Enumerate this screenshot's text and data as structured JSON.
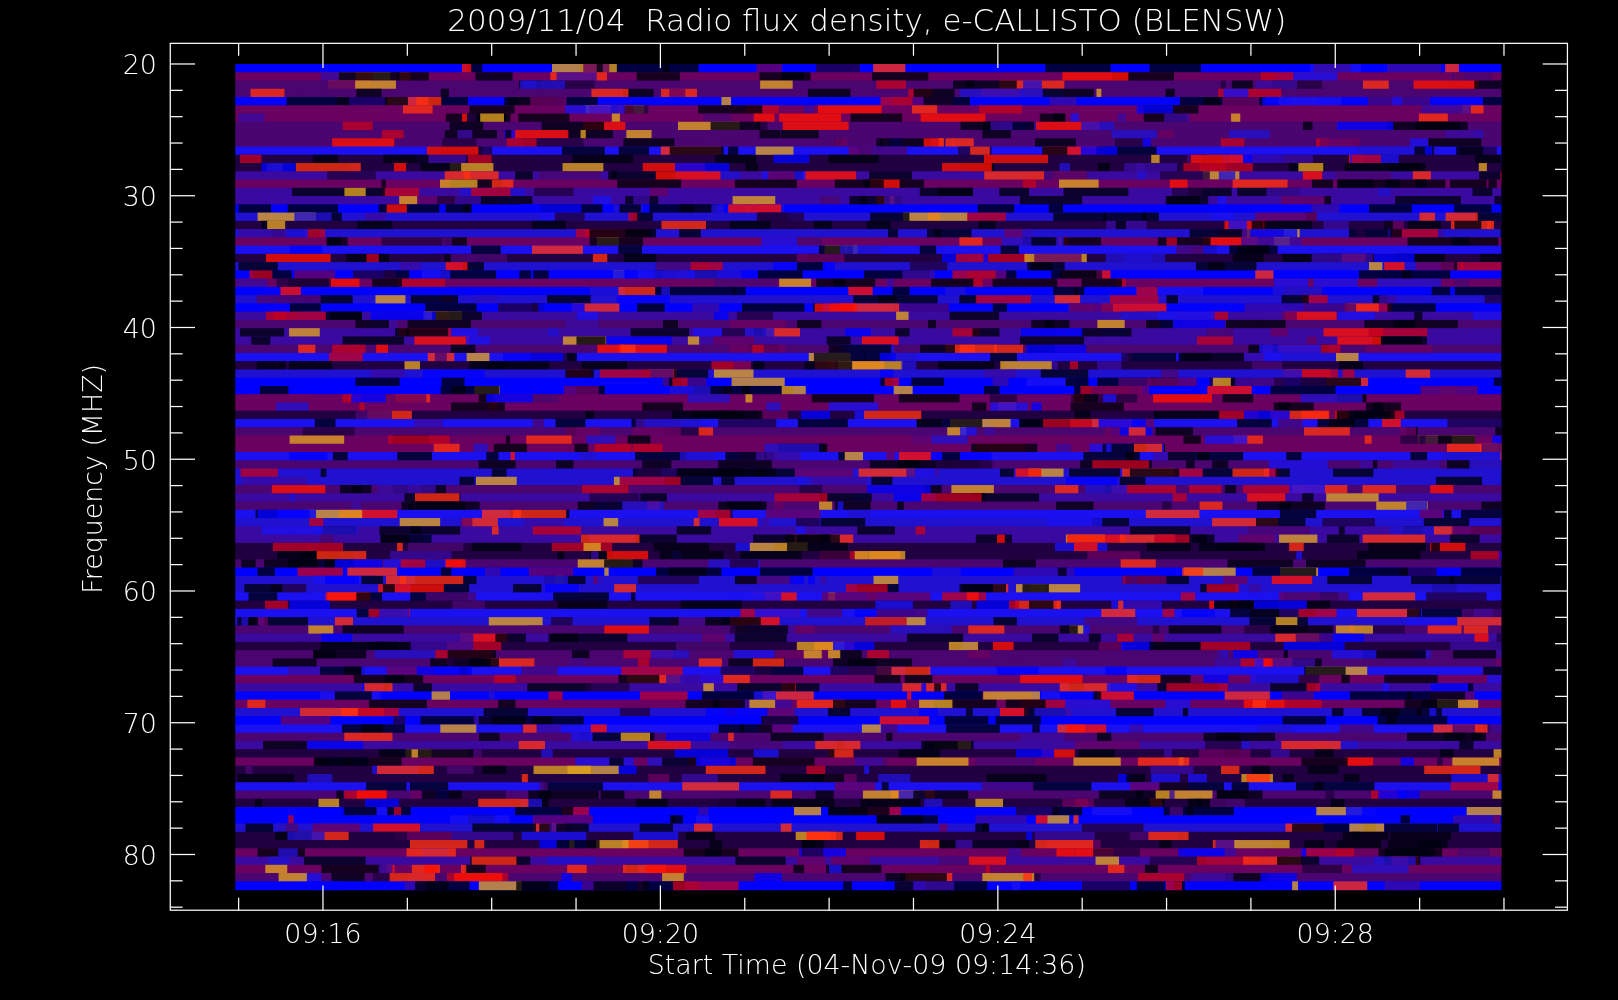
{
  "plot": {
    "title": "2009/11/04  Radio flux density, e-CALLISTO (BLENSW)",
    "ylabel": "Frequency (MHZ)",
    "xlabel": "Start Time (04-Nov-09 09:14:36)",
    "ytick_labels": [
      "20",
      "30",
      "40",
      "50",
      "60",
      "70",
      "80"
    ],
    "xtick_labels": [
      "09:16",
      "09:20",
      "09:24",
      "09:28"
    ]
  }
}
